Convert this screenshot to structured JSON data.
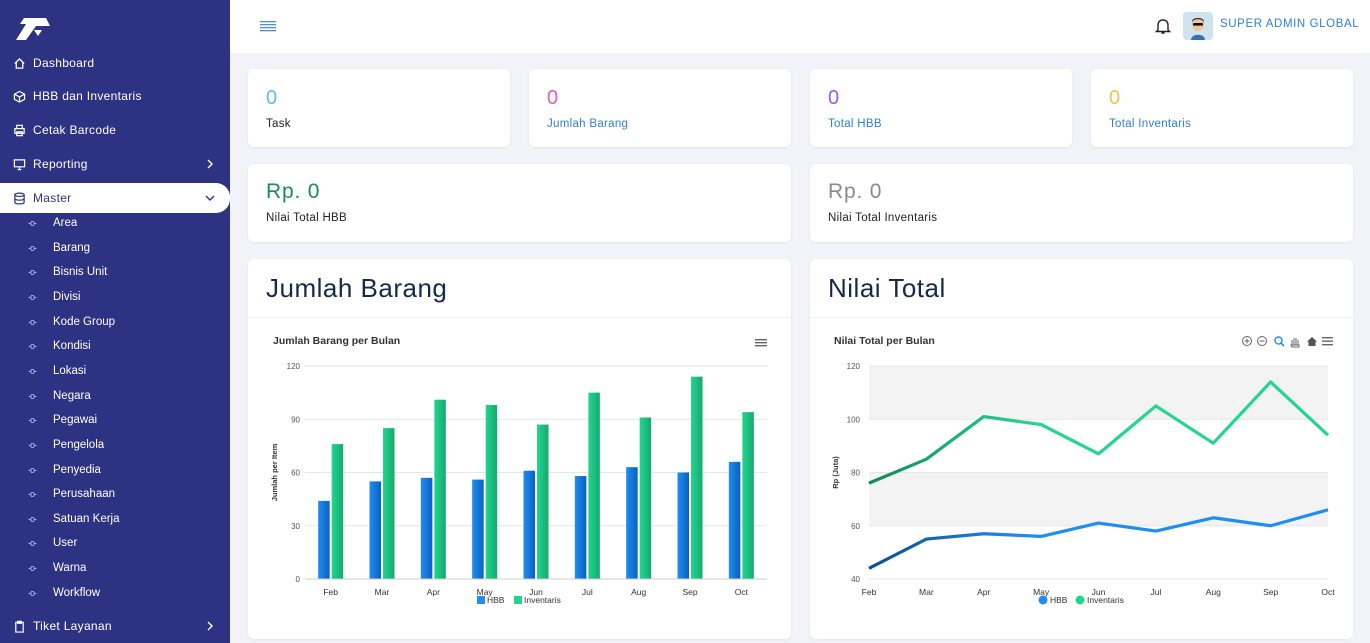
{
  "sidebar": {
    "nav": [
      {
        "label": "Dashboard",
        "icon": "home-icon"
      },
      {
        "label": "HBB dan Inventaris",
        "icon": "box-icon"
      },
      {
        "label": "Cetak Barcode",
        "icon": "printer-icon"
      },
      {
        "label": "Reporting",
        "icon": "monitor-icon"
      },
      {
        "label": "Master",
        "icon": "database-icon"
      }
    ],
    "master_items": [
      "Area",
      "Barang",
      "Bisnis Unit",
      "Divisi",
      "Kode Group",
      "Kondisi",
      "Lokasi",
      "Negara",
      "Pegawai",
      "Pengelola",
      "Penyedia",
      "Perusahaan",
      "Satuan Kerja",
      "User",
      "Warna",
      "Workflow"
    ],
    "bottom_nav": {
      "label": "Tiket Layanan",
      "icon": "clipboard-icon"
    },
    "sub_bullet": "-o-"
  },
  "topbar": {
    "username": "SUPER ADMIN GLOBAL"
  },
  "stats": [
    {
      "value": "0",
      "label": "Task",
      "color": "#5bc0eb",
      "label_color": "#222222"
    },
    {
      "value": "0",
      "label": "Jumlah Barang",
      "color": "#e05bd0",
      "label_color": "#2f7fd6"
    },
    {
      "value": "0",
      "label": "Total HBB",
      "color": "#9b59e6",
      "label_color": "#2f7fd6"
    },
    {
      "value": "0",
      "label": "Total Inventaris",
      "color": "#f2c14e",
      "label_color": "#2f7fd6"
    }
  ],
  "totals": [
    {
      "value": "Rp. 0",
      "label": "Nilai Total HBB",
      "color": "#1e8a5a"
    },
    {
      "value": "Rp. 0",
      "label": "Nilai Total Inventaris",
      "color": "#8a8a8a"
    }
  ],
  "panels": {
    "left_title": "Jumlah Barang",
    "right_title": "Nilai Total"
  },
  "chart_data": [
    {
      "type": "bar",
      "title": "Jumlah Barang per Bulan",
      "xlabel": "",
      "ylabel": "Jumlah per Item",
      "categories": [
        "Feb",
        "Mar",
        "Apr",
        "May",
        "Jun",
        "Jul",
        "Aug",
        "Sep",
        "Oct"
      ],
      "series": [
        {
          "name": "HBB",
          "values": [
            44,
            55,
            57,
            56,
            61,
            58,
            63,
            60,
            66
          ],
          "color": "#1f8ef1"
        },
        {
          "name": "Inventaris",
          "values": [
            76,
            85,
            101,
            98,
            87,
            105,
            91,
            114,
            94
          ],
          "color": "#22d690"
        }
      ],
      "ylim": [
        0,
        120
      ],
      "yticks": [
        0,
        30,
        60,
        90,
        120
      ],
      "grid": true,
      "legend": "bottom-center"
    },
    {
      "type": "line",
      "title": "Nilai Total per Bulan",
      "xlabel": "",
      "ylabel": "Rp (Juta)",
      "categories": [
        "Feb",
        "Mar",
        "Apr",
        "May",
        "Jun",
        "Jul",
        "Aug",
        "Sep",
        "Oct"
      ],
      "series": [
        {
          "name": "HBB",
          "values": [
            44,
            55,
            57,
            56,
            61,
            58,
            63,
            60,
            66
          ],
          "color": "#1f8ef1"
        },
        {
          "name": "Inventaris",
          "values": [
            76,
            85,
            101,
            98,
            87,
            105,
            91,
            114,
            94
          ],
          "color": "#22d690"
        }
      ],
      "ylim": [
        40,
        120
      ],
      "yticks": [
        40,
        60,
        80,
        100,
        120
      ],
      "grid": true,
      "legend": "bottom-center"
    }
  ]
}
